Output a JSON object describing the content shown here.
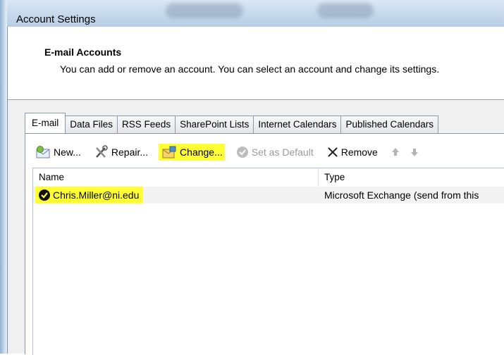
{
  "window": {
    "title": "Account Settings"
  },
  "header": {
    "title": "E-mail Accounts",
    "description": "You can add or remove an account. You can select an account and change its settings."
  },
  "tabs": [
    {
      "label": "E-mail",
      "active": true
    },
    {
      "label": "Data Files"
    },
    {
      "label": "RSS Feeds"
    },
    {
      "label": "SharePoint Lists"
    },
    {
      "label": "Internet Calendars"
    },
    {
      "label": "Published Calendars"
    }
  ],
  "toolbar": {
    "new_label": "New...",
    "repair_label": "Repair...",
    "change_label": "Change...",
    "set_default_label": "Set as Default",
    "remove_label": "Remove"
  },
  "list": {
    "columns": {
      "name": "Name",
      "type": "Type"
    },
    "rows": [
      {
        "name": "Chris.Miller@ni.edu",
        "type": "Microsoft Exchange (send from this"
      }
    ]
  },
  "colors": {
    "highlight": "#ffff33",
    "default_check": "#1e9e1e"
  },
  "icons": [
    "new-account-icon",
    "repair-icon",
    "change-icon",
    "set-default-icon",
    "remove-icon",
    "move-up-icon",
    "move-down-icon",
    "default-account-check-icon"
  ]
}
